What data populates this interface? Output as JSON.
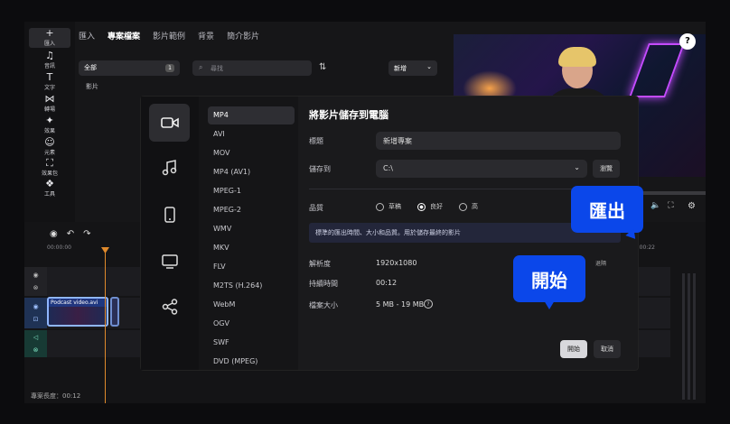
{
  "rail": {
    "items": [
      {
        "icon": "plus-icon",
        "glyph": "+",
        "label": "匯入"
      },
      {
        "icon": "music-note-icon",
        "glyph": "♫",
        "label": "音訊"
      },
      {
        "icon": "text-icon",
        "glyph": "T",
        "label": "文字"
      },
      {
        "icon": "transition-icon",
        "glyph": "⋈",
        "label": "轉場"
      },
      {
        "icon": "sparkle-icon",
        "glyph": "✦",
        "label": "效果"
      },
      {
        "icon": "sticker-icon",
        "glyph": "☺",
        "label": "元素"
      },
      {
        "icon": "bag-icon",
        "glyph": "⛶",
        "label": "效果包"
      },
      {
        "icon": "tools-icon",
        "glyph": "❖",
        "label": "工具"
      }
    ]
  },
  "media_tabs": [
    "匯入",
    "專案檔案",
    "影片範例",
    "背景",
    "簡介影片"
  ],
  "media": {
    "all_label": "全部",
    "all_count": "1",
    "search_placeholder": "尋找",
    "new_label": "新增",
    "clips_label": "影片"
  },
  "timeline": {
    "ruler": [
      "00:00:00",
      "00:00:22"
    ],
    "clip_title": "Podcast video.avi",
    "duration_label": "專案長度：00:12",
    "undock_label": "退隔"
  },
  "export_button": {
    "label": "匯出"
  },
  "modal": {
    "title": "將影片儲存到電腦",
    "formats": [
      "MP4",
      "AVI",
      "MOV",
      "MP4 (AV1)",
      "MPEG-1",
      "MPEG-2",
      "WMV",
      "MKV",
      "FLV",
      "M2TS (H.264)",
      "WebM",
      "OGV",
      "SWF",
      "DVD (MPEG)"
    ],
    "fields": {
      "title_label": "標題",
      "title_value": "新增專案",
      "save_to_label": "儲存到",
      "save_to_value": "C:\\",
      "browse_label": "瀏覽",
      "quality_label": "品質",
      "quality_options": [
        "草稿",
        "良好",
        "高"
      ],
      "quality_selected": "良好",
      "note": "標準的匯出時間、大小和品質。用於儲存最終的影片",
      "resolution_label": "解析度",
      "resolution_value": "1920x1080",
      "duration_label": "持續時間",
      "duration_value": "00:12",
      "filesize_label": "檔案大小",
      "filesize_value": "5 MB - 19 MB"
    },
    "start_label": "開始",
    "cancel_label": "取消"
  },
  "callouts": {
    "export": "匯出",
    "start": "開始"
  },
  "colors": {
    "accent": "#1a55e3",
    "callout": "#0b47ea",
    "playhead": "#e08a2c"
  }
}
